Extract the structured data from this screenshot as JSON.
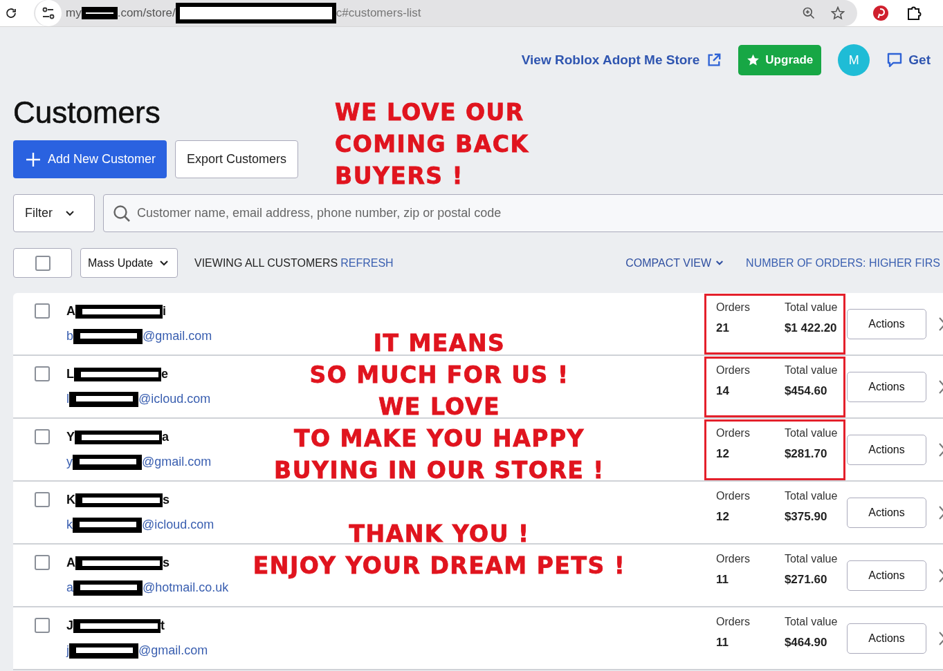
{
  "browser": {
    "url_start": "my",
    "url_middle": ".com/store/",
    "url_end": "c#customers-list"
  },
  "header": {
    "store_link": "View Roblox Adopt Me Store",
    "upgrade": "Upgrade",
    "avatar": "M",
    "help": "Get"
  },
  "title": "Customers",
  "buttons": {
    "add": "Add New Customer",
    "export": "Export Customers"
  },
  "filter": {
    "label": "Filter",
    "search_placeholder": "Customer name, email address, phone number, zip or postal code"
  },
  "toolbar": {
    "select_all_checked": false,
    "mass_update": "Mass Update",
    "viewing": "VIEWING ALL CUSTOMERS",
    "refresh": "REFRESH",
    "view": "COMPACT VIEW",
    "sort": "NUMBER OF ORDERS: HIGHER FIRS"
  },
  "customers": [
    {
      "name_start": "A",
      "name_end": "i",
      "email_start": "b",
      "email_end": "@gmail.com",
      "orders_label": "Orders",
      "orders": "21",
      "total_label": "Total value",
      "total": "$1 422.20",
      "action": "Actions",
      "checked": false,
      "highlighted": true
    },
    {
      "name_start": "L",
      "name_end": "e",
      "email_start": "l",
      "email_end": "@icloud.com",
      "orders_label": "Orders",
      "orders": "14",
      "total_label": "Total value",
      "total": "$454.60",
      "action": "Actions",
      "checked": false,
      "highlighted": true
    },
    {
      "name_start": "Y",
      "name_end": "a",
      "email_start": "y",
      "email_end": "@gmail.com",
      "orders_label": "Orders",
      "orders": "12",
      "total_label": "Total value",
      "total": "$281.70",
      "action": "Actions",
      "checked": false,
      "highlighted": true
    },
    {
      "name_start": "K",
      "name_end": "s",
      "email_start": "k",
      "email_end": "@icloud.com",
      "orders_label": "Orders",
      "orders": "12",
      "total_label": "Total value",
      "total": "$375.90",
      "action": "Actions",
      "checked": false,
      "highlighted": false
    },
    {
      "name_start": "A",
      "name_end": "s",
      "email_start": "a",
      "email_end": "@hotmail.co.uk",
      "orders_label": "Orders",
      "orders": "11",
      "total_label": "Total value",
      "total": "$271.60",
      "action": "Actions",
      "checked": false,
      "highlighted": false
    },
    {
      "name_start": "J",
      "name_end": "t",
      "email_start": "j",
      "email_end": "@gmail.com",
      "orders_label": "Orders",
      "orders": "11",
      "total_label": "Total value",
      "total": "$464.90",
      "action": "Actions",
      "checked": false,
      "highlighted": false
    }
  ],
  "annotations": [
    {
      "lines": [
        "WE LOVE OUR",
        "COMING BACK",
        "BUYERS !"
      ]
    },
    {
      "lines": [
        "IT MEANS",
        "SO MUCH FOR US !",
        "WE LOVE",
        "TO MAKE YOU HAPPY",
        "BUYING IN OUR STORE !"
      ]
    },
    {
      "lines": [
        "THANK YOU !",
        "ENJOY YOUR DREAM PETS !"
      ]
    }
  ]
}
